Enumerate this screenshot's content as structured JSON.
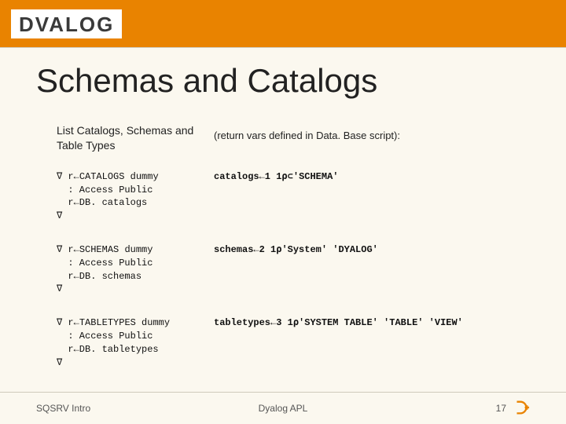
{
  "header": {
    "logo_text": "DVALOG"
  },
  "title": "Schemas and Catalogs",
  "intro": {
    "left": "List Catalogs, Schemas and Table Types",
    "right": "(return vars defined in Data. Base script):"
  },
  "blocks": [
    {
      "code": "∇ r←CATALOGS dummy\n  : Access Public\n  r←DB. catalogs\n∇",
      "result": "catalogs←1 1⍴⊂'SCHEMA'"
    },
    {
      "code": "∇ r←SCHEMAS dummy\n  : Access Public\n  r←DB. schemas\n∇",
      "result": "schemas←2 1⍴'System' 'DYALOG'"
    },
    {
      "code": "∇ r←TABLETYPES dummy\n  : Access Public\n  r←DB. tabletypes\n∇",
      "result": "tabletypes←3 1⍴'SYSTEM TABLE' 'TABLE' 'VIEW'"
    }
  ],
  "footer": {
    "left": "SQSRV Intro",
    "center": "Dyalog APL",
    "page": "17"
  }
}
